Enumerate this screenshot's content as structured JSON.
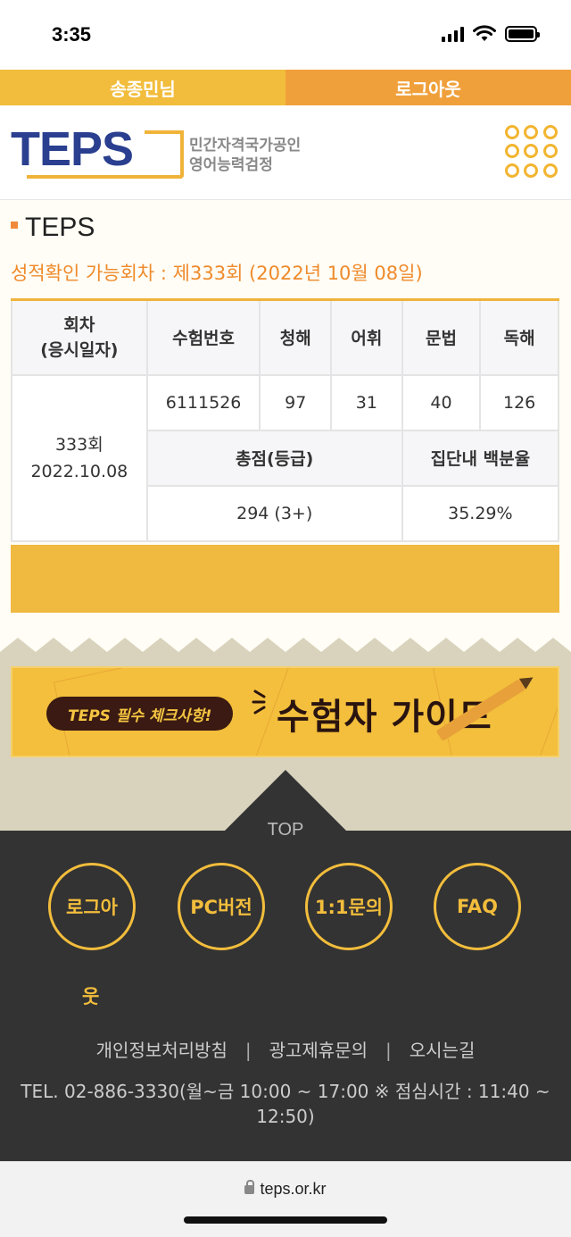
{
  "status_bar": {
    "time": "3:35"
  },
  "user_bar": {
    "user_name": "송종민님",
    "logout_label": "로그아웃"
  },
  "header": {
    "logo_text": "TEPS",
    "slogan_line1": "민간자격국가공인",
    "slogan_line2": "영어능력검정"
  },
  "content": {
    "section_title": "TEPS",
    "exam_info": "성적확인 가능회차 : 제333회 (2022년 10월 08일)",
    "table": {
      "headers": {
        "round_line1": "회차",
        "round_line2": "(응시일자)",
        "exam_number": "수험번호",
        "listening": "청해",
        "vocabulary": "어휘",
        "grammar": "문법",
        "reading": "독해"
      },
      "row": {
        "round": "333회",
        "date": "2022.10.08",
        "exam_number": "6111526",
        "listening": "97",
        "vocabulary": "31",
        "grammar": "40",
        "reading": "126"
      },
      "subheaders": {
        "total": "총점(등급)",
        "percentile": "집단내 백분율"
      },
      "totals": {
        "total": "294 (3+)",
        "percentile": "35.29%"
      }
    }
  },
  "guide_banner": {
    "pill": "TEPS 필수 체크사항!",
    "title": "수험자 가이드"
  },
  "footer": {
    "top_label": "TOP",
    "buttons": {
      "logout_main": "로그아",
      "logout_overflow": "웃",
      "pc": "PC버전",
      "inquiry": "1:1문의",
      "faq": "FAQ"
    },
    "links": {
      "privacy": "개인정보처리방침",
      "ads": "광고제휴문의",
      "directions": "오시는길",
      "separator": "|"
    },
    "tel": "TEL. 02-886-3330(월~금 10:00 ~ 17:00 ※ 점심시간 : 11:40 ~ 12:50)"
  },
  "url_bar": {
    "url": "teps.or.kr"
  },
  "colors": {
    "accent_yellow": "#f2bd3c",
    "accent_orange": "#f0a03a",
    "logo_blue": "#2a3f8f",
    "footer_bg": "#333333"
  }
}
